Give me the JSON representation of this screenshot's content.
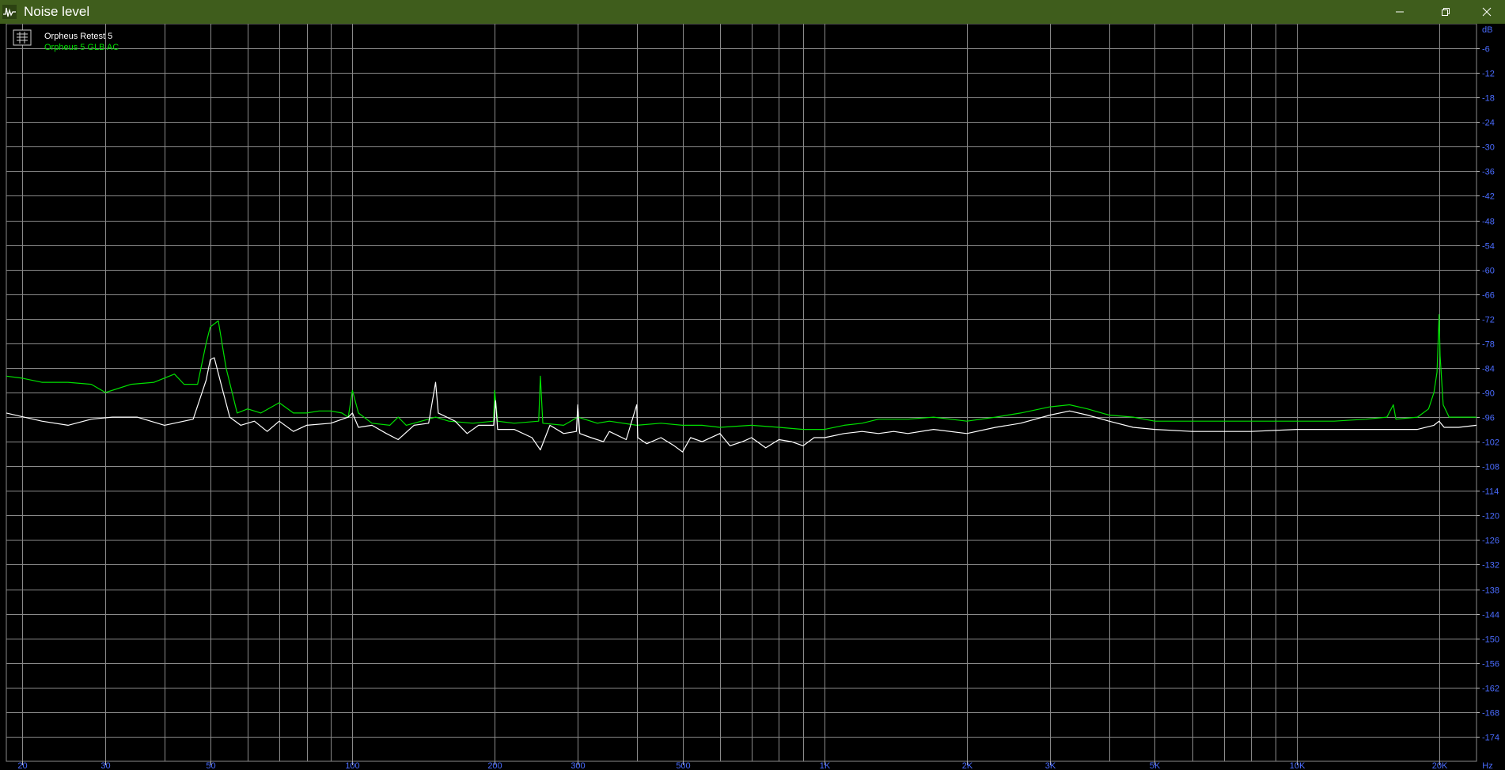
{
  "window": {
    "title": "Noise level",
    "min_icon": "minimize-icon",
    "max_icon": "restore-icon",
    "close_icon": "close-icon",
    "titlebar_color": "#3f5d1c"
  },
  "legend": {
    "entries": [
      {
        "label": "Orpheus Retest 5",
        "color": "#ffffff"
      },
      {
        "label": "Orpheus 5 GLB AC",
        "color": "#00e000"
      }
    ]
  },
  "chart_data": {
    "type": "line",
    "x_scale": "log",
    "x_unit_label": "Hz",
    "y_unit_label": "dB",
    "xlim": [
      18.5,
      24000
    ],
    "ylim": [
      -180,
      0
    ],
    "x_ticks": [
      {
        "value": 20,
        "label": "20"
      },
      {
        "value": 30,
        "label": "30"
      },
      {
        "value": 50,
        "label": "50"
      },
      {
        "value": 100,
        "label": "100"
      },
      {
        "value": 200,
        "label": "200"
      },
      {
        "value": 300,
        "label": "300"
      },
      {
        "value": 500,
        "label": "500"
      },
      {
        "value": 1000,
        "label": "1K"
      },
      {
        "value": 2000,
        "label": "2K"
      },
      {
        "value": 3000,
        "label": "3K"
      },
      {
        "value": 5000,
        "label": "5K"
      },
      {
        "value": 10000,
        "label": "10K"
      },
      {
        "value": 20000,
        "label": "20K"
      }
    ],
    "x_minor_grid": [
      40,
      60,
      70,
      80,
      90,
      400,
      600,
      700,
      800,
      900,
      4000,
      6000,
      7000,
      8000,
      9000
    ],
    "y_ticks": [
      -6,
      -12,
      -18,
      -24,
      -30,
      -36,
      -42,
      -48,
      -54,
      -60,
      -66,
      -72,
      -78,
      -84,
      -90,
      -96,
      -102,
      -108,
      -114,
      -120,
      -126,
      -132,
      -138,
      -144,
      -150,
      -156,
      -162,
      -168,
      -174
    ],
    "grid": true,
    "legend_position": "top-left",
    "series": [
      {
        "name": "Orpheus Retest 5",
        "color": "#ffffff",
        "points": [
          [
            18.5,
            -95
          ],
          [
            22,
            -97
          ],
          [
            25,
            -98
          ],
          [
            28,
            -96.5
          ],
          [
            31,
            -96
          ],
          [
            35,
            -96
          ],
          [
            40,
            -98
          ],
          [
            46,
            -96.5
          ],
          [
            49,
            -87
          ],
          [
            50,
            -82
          ],
          [
            51,
            -81.5
          ],
          [
            53,
            -89
          ],
          [
            55,
            -96
          ],
          [
            58,
            -98
          ],
          [
            62,
            -97
          ],
          [
            66,
            -99.5
          ],
          [
            70,
            -97
          ],
          [
            75,
            -99.5
          ],
          [
            80,
            -98
          ],
          [
            90,
            -97.5
          ],
          [
            98,
            -96
          ],
          [
            100,
            -95
          ],
          [
            103,
            -98.5
          ],
          [
            110,
            -98
          ],
          [
            118,
            -100
          ],
          [
            125,
            -101.5
          ],
          [
            135,
            -98
          ],
          [
            145,
            -97.5
          ],
          [
            150,
            -87.5
          ],
          [
            152,
            -95
          ],
          [
            165,
            -97
          ],
          [
            175,
            -100
          ],
          [
            185,
            -98
          ],
          [
            199,
            -98
          ],
          [
            201,
            -92
          ],
          [
            203,
            -99
          ],
          [
            220,
            -99
          ],
          [
            240,
            -101
          ],
          [
            250,
            -104
          ],
          [
            262,
            -98
          ],
          [
            280,
            -100
          ],
          [
            298,
            -99.5
          ],
          [
            300,
            -93
          ],
          [
            303,
            -100
          ],
          [
            320,
            -101
          ],
          [
            340,
            -102
          ],
          [
            350,
            -99.5
          ],
          [
            380,
            -101.5
          ],
          [
            400,
            -93
          ],
          [
            402,
            -101
          ],
          [
            420,
            -102.5
          ],
          [
            450,
            -101
          ],
          [
            480,
            -103
          ],
          [
            500,
            -104.5
          ],
          [
            520,
            -101
          ],
          [
            550,
            -102
          ],
          [
            600,
            -100
          ],
          [
            630,
            -103
          ],
          [
            670,
            -102
          ],
          [
            700,
            -101
          ],
          [
            750,
            -103.5
          ],
          [
            800,
            -101.5
          ],
          [
            850,
            -102
          ],
          [
            900,
            -103
          ],
          [
            950,
            -101
          ],
          [
            1000,
            -101
          ],
          [
            1100,
            -100
          ],
          [
            1200,
            -99.5
          ],
          [
            1300,
            -100
          ],
          [
            1400,
            -99.5
          ],
          [
            1500,
            -100
          ],
          [
            1700,
            -99
          ],
          [
            2000,
            -100
          ],
          [
            2300,
            -98.5
          ],
          [
            2600,
            -97.5
          ],
          [
            3000,
            -95.5
          ],
          [
            3300,
            -94.5
          ],
          [
            3600,
            -95.5
          ],
          [
            4000,
            -97
          ],
          [
            4500,
            -98.5
          ],
          [
            5000,
            -99
          ],
          [
            6000,
            -99.5
          ],
          [
            7000,
            -99.5
          ],
          [
            8000,
            -99.5
          ],
          [
            10000,
            -99
          ],
          [
            12000,
            -99
          ],
          [
            14000,
            -99
          ],
          [
            16000,
            -99
          ],
          [
            18000,
            -99
          ],
          [
            19500,
            -98
          ],
          [
            20000,
            -97
          ],
          [
            20500,
            -98.5
          ],
          [
            22000,
            -98.5
          ],
          [
            24000,
            -98
          ]
        ]
      },
      {
        "name": "Orpheus 5 GLB AC",
        "color": "#00e000",
        "points": [
          [
            18.5,
            -86
          ],
          [
            20,
            -86.5
          ],
          [
            22,
            -87.5
          ],
          [
            25,
            -87.5
          ],
          [
            28,
            -88
          ],
          [
            30,
            -90
          ],
          [
            34,
            -88
          ],
          [
            38,
            -87.5
          ],
          [
            42,
            -85.5
          ],
          [
            44,
            -88
          ],
          [
            47,
            -88
          ],
          [
            49,
            -78
          ],
          [
            50,
            -74
          ],
          [
            52,
            -72.5
          ],
          [
            54,
            -84
          ],
          [
            57,
            -95
          ],
          [
            60,
            -94
          ],
          [
            64,
            -95
          ],
          [
            70,
            -92.5
          ],
          [
            75,
            -95
          ],
          [
            80,
            -95
          ],
          [
            85,
            -94.5
          ],
          [
            90,
            -94.5
          ],
          [
            95,
            -95
          ],
          [
            98,
            -96
          ],
          [
            100,
            -89.5
          ],
          [
            103,
            -95
          ],
          [
            110,
            -97.5
          ],
          [
            120,
            -98
          ],
          [
            125,
            -96
          ],
          [
            130,
            -98
          ],
          [
            135,
            -97.5
          ],
          [
            150,
            -96
          ],
          [
            160,
            -97
          ],
          [
            180,
            -97.5
          ],
          [
            199,
            -97
          ],
          [
            200,
            -89.5
          ],
          [
            203,
            -97
          ],
          [
            220,
            -97.5
          ],
          [
            248,
            -97
          ],
          [
            250,
            -86
          ],
          [
            253,
            -97.5
          ],
          [
            280,
            -98
          ],
          [
            300,
            -96
          ],
          [
            330,
            -97.5
          ],
          [
            350,
            -97
          ],
          [
            400,
            -98
          ],
          [
            450,
            -97.5
          ],
          [
            500,
            -98
          ],
          [
            550,
            -98
          ],
          [
            600,
            -98.5
          ],
          [
            700,
            -98
          ],
          [
            800,
            -98.5
          ],
          [
            900,
            -99
          ],
          [
            1000,
            -99
          ],
          [
            1100,
            -98
          ],
          [
            1200,
            -97.5
          ],
          [
            1300,
            -96.5
          ],
          [
            1500,
            -96.5
          ],
          [
            1700,
            -96
          ],
          [
            2000,
            -97
          ],
          [
            2300,
            -96
          ],
          [
            2600,
            -95
          ],
          [
            3000,
            -93.5
          ],
          [
            3300,
            -93
          ],
          [
            3600,
            -94
          ],
          [
            4000,
            -95.5
          ],
          [
            4500,
            -96
          ],
          [
            5000,
            -97
          ],
          [
            6000,
            -97
          ],
          [
            7000,
            -97
          ],
          [
            8000,
            -97
          ],
          [
            10000,
            -97
          ],
          [
            12000,
            -97
          ],
          [
            14000,
            -96.5
          ],
          [
            15500,
            -96
          ],
          [
            16000,
            -93
          ],
          [
            16200,
            -96.5
          ],
          [
            18000,
            -96
          ],
          [
            19000,
            -94
          ],
          [
            19500,
            -90
          ],
          [
            19800,
            -85
          ],
          [
            20000,
            -71
          ],
          [
            20100,
            -81
          ],
          [
            20400,
            -93
          ],
          [
            21000,
            -96
          ],
          [
            22000,
            -96
          ],
          [
            24000,
            -96
          ]
        ]
      }
    ]
  }
}
